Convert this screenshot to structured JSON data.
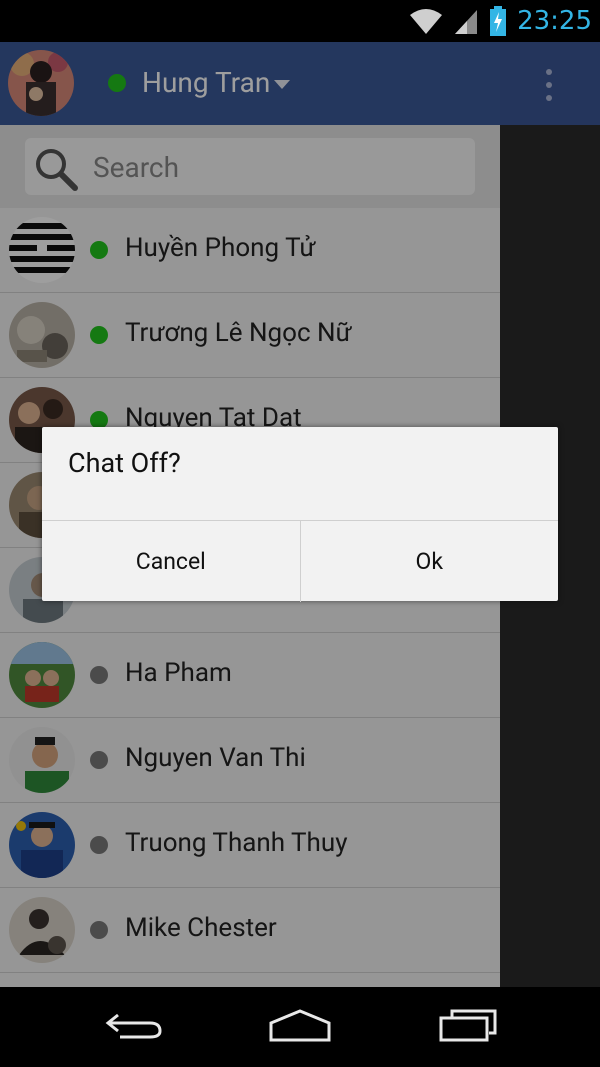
{
  "status_bar": {
    "time": "23:25",
    "icons": [
      "wifi-icon",
      "cell-signal-icon",
      "battery-charging-icon"
    ],
    "time_color": "#33b5e5"
  },
  "header": {
    "user_name": "Hung Tran",
    "status": "online",
    "bg_color": "#3b5998"
  },
  "search": {
    "placeholder": "Search"
  },
  "contacts": [
    {
      "name": "Huyền Phong Tử",
      "status": "online"
    },
    {
      "name": "Trương Lê Ngọc Nữ",
      "status": "online"
    },
    {
      "name": "Nguyen Tat Dat",
      "status": "online"
    },
    {
      "name": "",
      "status": "offline"
    },
    {
      "name": "",
      "status": "offline"
    },
    {
      "name": "Ha Pham",
      "status": "offline"
    },
    {
      "name": "Nguyen Van Thi",
      "status": "offline"
    },
    {
      "name": "Truong Thanh Thuy",
      "status": "offline"
    },
    {
      "name": "Mike Chester",
      "status": "offline"
    }
  ],
  "colors": {
    "online": "#22c41e",
    "offline": "#7a7a7a"
  },
  "dialog": {
    "title": "Chat Off?",
    "cancel_label": "Cancel",
    "ok_label": "Ok"
  },
  "nav": [
    "back-icon",
    "home-icon",
    "recent-apps-icon"
  ]
}
